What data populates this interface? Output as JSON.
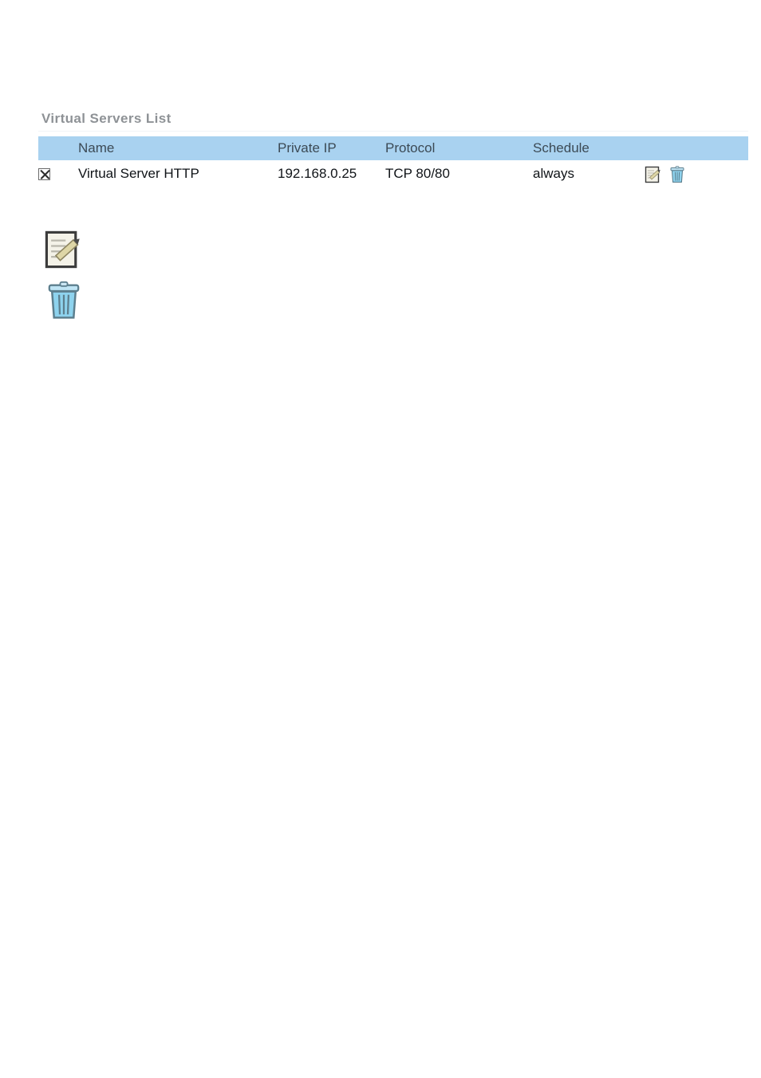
{
  "panel": {
    "title": "Virtual Servers List"
  },
  "table": {
    "columns": [
      {
        "key": "select",
        "label": ""
      },
      {
        "key": "name",
        "label": "Name"
      },
      {
        "key": "privateip",
        "label": "Private IP"
      },
      {
        "key": "protocol",
        "label": "Protocol"
      },
      {
        "key": "schedule",
        "label": "Schedule"
      },
      {
        "key": "actions",
        "label": ""
      }
    ],
    "rows": [
      {
        "selected": true,
        "name": "Virtual Server HTTP",
        "private_ip": "192.168.0.25",
        "protocol": "TCP 80/80",
        "schedule": "always",
        "edit_icon": "edit-note-icon",
        "delete_icon": "trash-can-icon"
      }
    ]
  },
  "legend": {
    "edit_icon": "edit-note-icon",
    "delete_icon": "trash-can-icon"
  },
  "colors": {
    "header_band": "#a9d2f0",
    "title_text": "#8e9296",
    "header_text": "#3c4a55",
    "cell_text": "#101418",
    "page_background": "#ffffff",
    "trash_body": "#8ed3ee",
    "trash_outline": "#5d7f8e",
    "note_paper": "#f4f2e8",
    "note_border": "#3c3c3c",
    "pencil_body": "#d8d0a0"
  }
}
